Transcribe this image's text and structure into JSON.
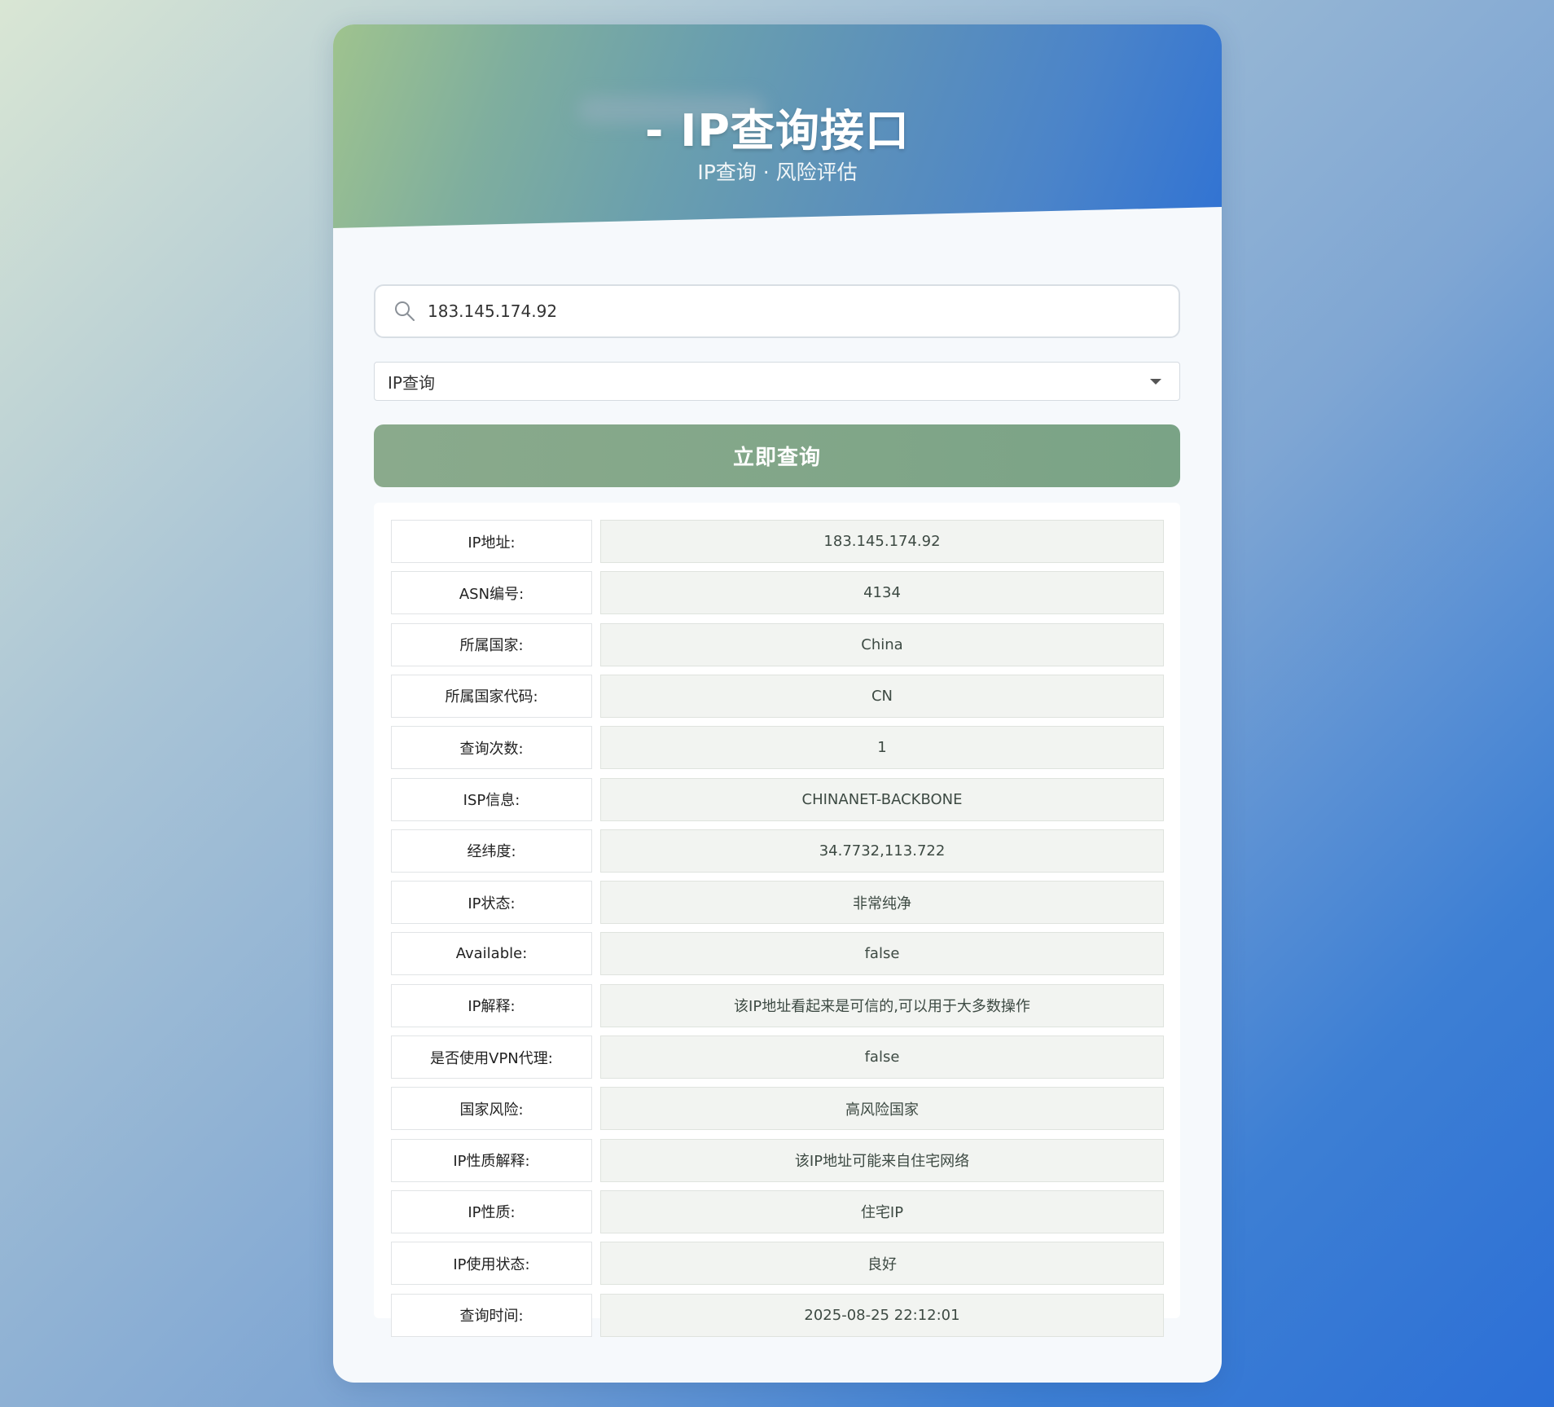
{
  "header": {
    "title": "- IP查询接口",
    "subtitle": "IP查询 · 风险评估"
  },
  "search": {
    "value": "183.145.174.92",
    "icon": "search-icon"
  },
  "mode_select": {
    "selected": "IP查询"
  },
  "query_button": {
    "label": "立即查询"
  },
  "results": [
    {
      "label": "IP地址:",
      "value": "183.145.174.92"
    },
    {
      "label": "ASN编号:",
      "value": "4134"
    },
    {
      "label": "所属国家:",
      "value": "China"
    },
    {
      "label": "所属国家代码:",
      "value": "CN"
    },
    {
      "label": "查询次数:",
      "value": "1"
    },
    {
      "label": "ISP信息:",
      "value": "CHINANET-BACKBONE"
    },
    {
      "label": "经纬度:",
      "value": "34.7732,113.722"
    },
    {
      "label": "IP状态:",
      "value": "非常纯净"
    },
    {
      "label": "Available:",
      "value": "false"
    },
    {
      "label": "IP解释:",
      "value": "该IP地址看起来是可信的,可以用于大多数操作"
    },
    {
      "label": "是否使用VPN代理:",
      "value": "false"
    },
    {
      "label": "国家风险:",
      "value": "高风险国家"
    },
    {
      "label": "IP性质解释:",
      "value": "该IP地址可能来自住宅网络"
    },
    {
      "label": "IP性质:",
      "value": "住宅IP"
    },
    {
      "label": "IP使用状态:",
      "value": "良好"
    },
    {
      "label": "查询时间:",
      "value": "2025-08-25 22:12:01"
    }
  ]
}
